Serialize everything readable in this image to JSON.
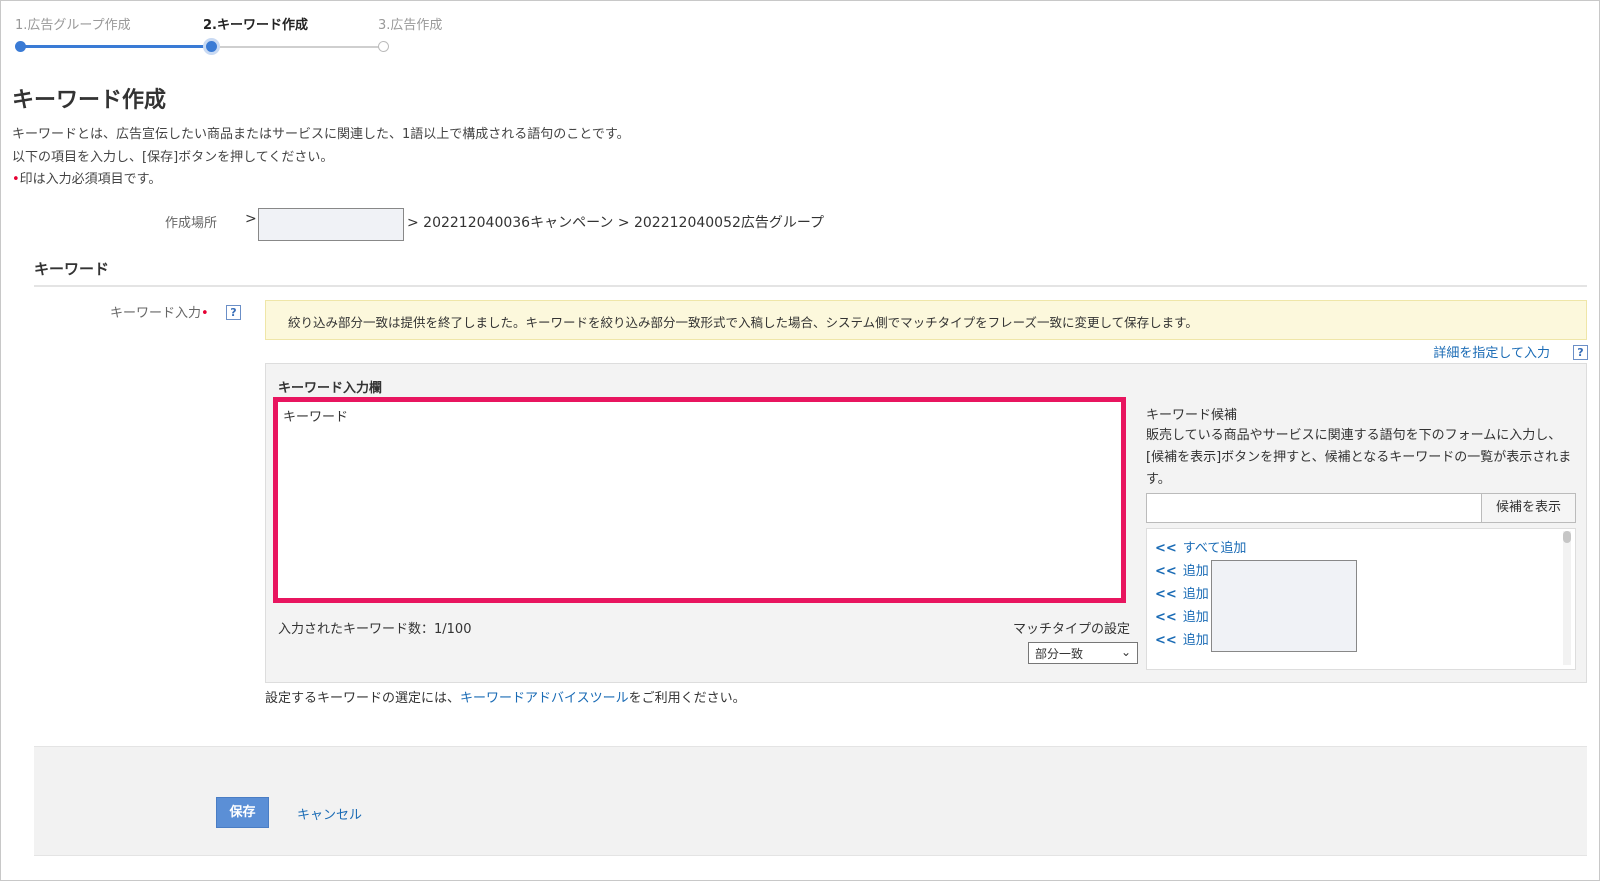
{
  "stepper": {
    "steps": [
      {
        "label": "1.広告グループ作成",
        "state": "done"
      },
      {
        "label": "2.キーワード作成",
        "state": "current"
      },
      {
        "label": "3.広告作成",
        "state": "pending"
      }
    ],
    "active_color": "#3a7bd5"
  },
  "page": {
    "title": "キーワード作成",
    "desc_lines": [
      "キーワードとは、広告宣伝したい商品またはサービスに関連した、1語以上で構成される語句のことです。",
      "以下の項目を入力し、[保存]ボタンを押してください。",
      "印は入力必須項目です。"
    ],
    "required_mark": "•"
  },
  "location": {
    "label": "作成場所",
    "separator": ">",
    "path": "> 202212040036キャンペーン > 202212040052広告グループ"
  },
  "keyword_section": {
    "title": "キーワード",
    "input_label": "キーワード入力",
    "required_mark": "•",
    "help_icon": "?",
    "notice": "絞り込み部分一致は提供を終了しました。キーワードを絞り込み部分一致形式で入稿した場合、システム側でマッチタイプをフレーズ一致に変更して保存します。",
    "detail_link": "詳細を指定して入力"
  },
  "panel": {
    "title": "キーワード入力欄",
    "textarea_value": "キーワード",
    "count_text": "入力されたキーワード数：1/100",
    "match_label": "マッチタイプの設定",
    "match_value": "部分一致",
    "highlight_color": "#e8155f"
  },
  "candidates": {
    "title": "キーワード候補",
    "desc": "販売している商品やサービスに関連する語句を下のフォームに入力し、[候補を表示]ボタンを押すと、候補となるキーワードの一覧が表示されます。",
    "button": "候補を表示",
    "arrow": "<<",
    "add_all": "すべて追加",
    "add": "追加"
  },
  "advice": {
    "before": "設定するキーワードの選定には、",
    "link": "キーワードアドバイスツール",
    "after": "をご利用ください。"
  },
  "footer": {
    "save": "保存",
    "cancel": "キャンセル"
  }
}
